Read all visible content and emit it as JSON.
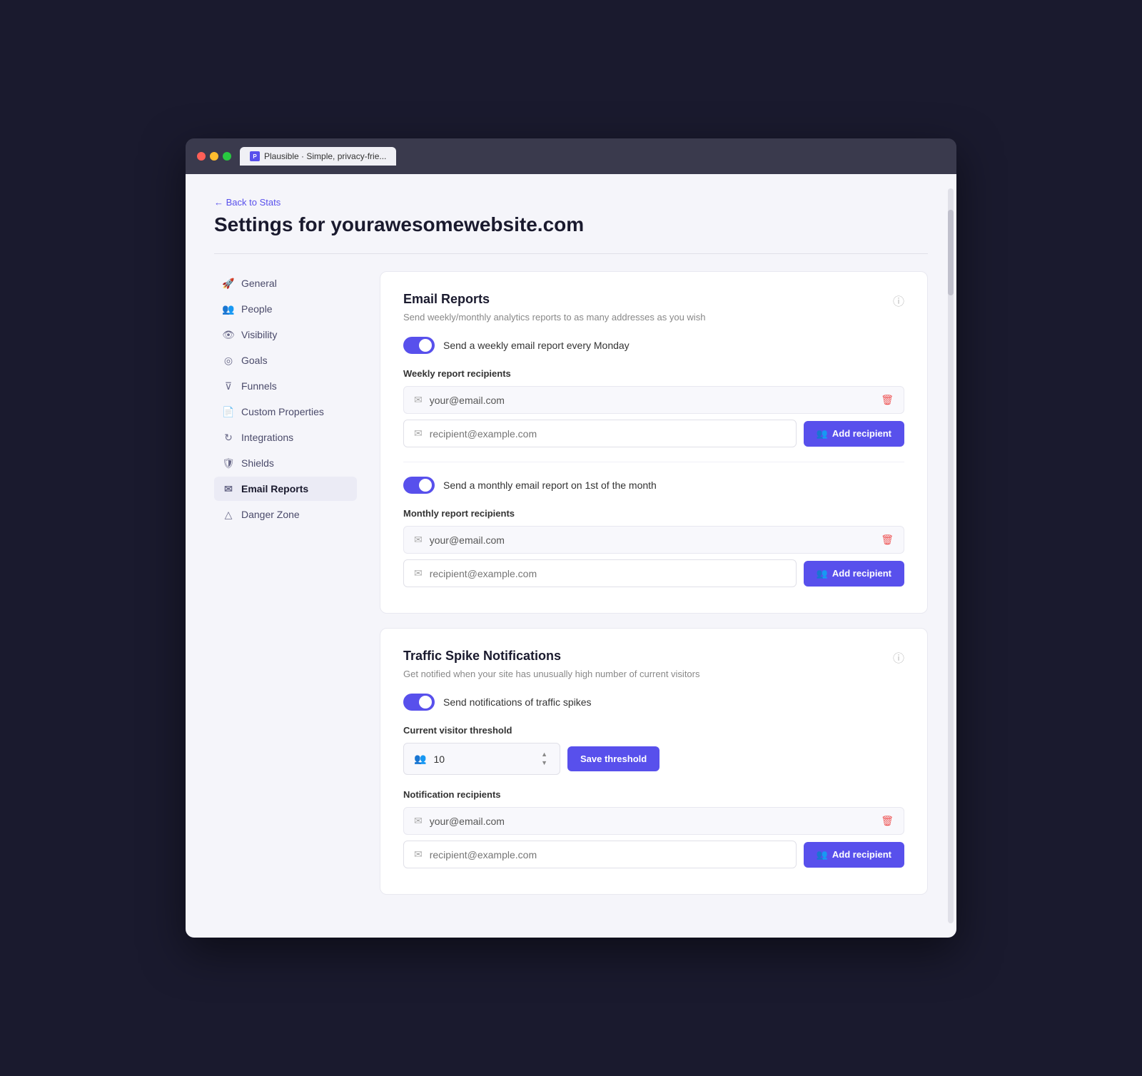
{
  "browser": {
    "tab_label": "Plausible · Simple, privacy-frie...",
    "favicon_letter": "P"
  },
  "page": {
    "back_label": "← Back to Stats",
    "title": "Settings for yourawesomewebsite.com"
  },
  "sidebar": {
    "items": [
      {
        "id": "general",
        "label": "General",
        "icon": "rocket"
      },
      {
        "id": "people",
        "label": "People",
        "icon": "people"
      },
      {
        "id": "visibility",
        "label": "Visibility",
        "icon": "eye"
      },
      {
        "id": "goals",
        "label": "Goals",
        "icon": "target"
      },
      {
        "id": "funnels",
        "label": "Funnels",
        "icon": "funnel"
      },
      {
        "id": "custom-properties",
        "label": "Custom Properties",
        "icon": "file"
      },
      {
        "id": "integrations",
        "label": "Integrations",
        "icon": "integrations"
      },
      {
        "id": "shields",
        "label": "Shields",
        "icon": "shield"
      },
      {
        "id": "email-reports",
        "label": "Email Reports",
        "icon": "email",
        "active": true
      },
      {
        "id": "danger-zone",
        "label": "Danger Zone",
        "icon": "danger"
      }
    ]
  },
  "email_reports": {
    "title": "Email Reports",
    "subtitle": "Send weekly/monthly analytics reports to as many addresses as you wish",
    "info_icon": "ⓘ",
    "weekly": {
      "toggle_label": "Send a weekly email report every Monday",
      "section_label": "Weekly report recipients",
      "existing_email": "your@email.com",
      "placeholder": "recipient@example.com",
      "add_btn": "Add recipient"
    },
    "monthly": {
      "toggle_label": "Send a monthly email report on 1st of the month",
      "section_label": "Monthly report recipients",
      "existing_email": "your@email.com",
      "placeholder": "recipient@example.com",
      "add_btn": "Add recipient"
    }
  },
  "traffic_spike": {
    "title": "Traffic Spike Notifications",
    "subtitle": "Get notified when your site has unusually high number of current visitors",
    "info_icon": "ⓘ",
    "toggle_label": "Send notifications of traffic spikes",
    "threshold_label": "Current visitor threshold",
    "threshold_value": "10",
    "save_btn": "Save threshold",
    "recipients_label": "Notification recipients",
    "existing_email": "your@email.com",
    "placeholder": "recipient@example.com",
    "add_btn": "Add recipient"
  }
}
